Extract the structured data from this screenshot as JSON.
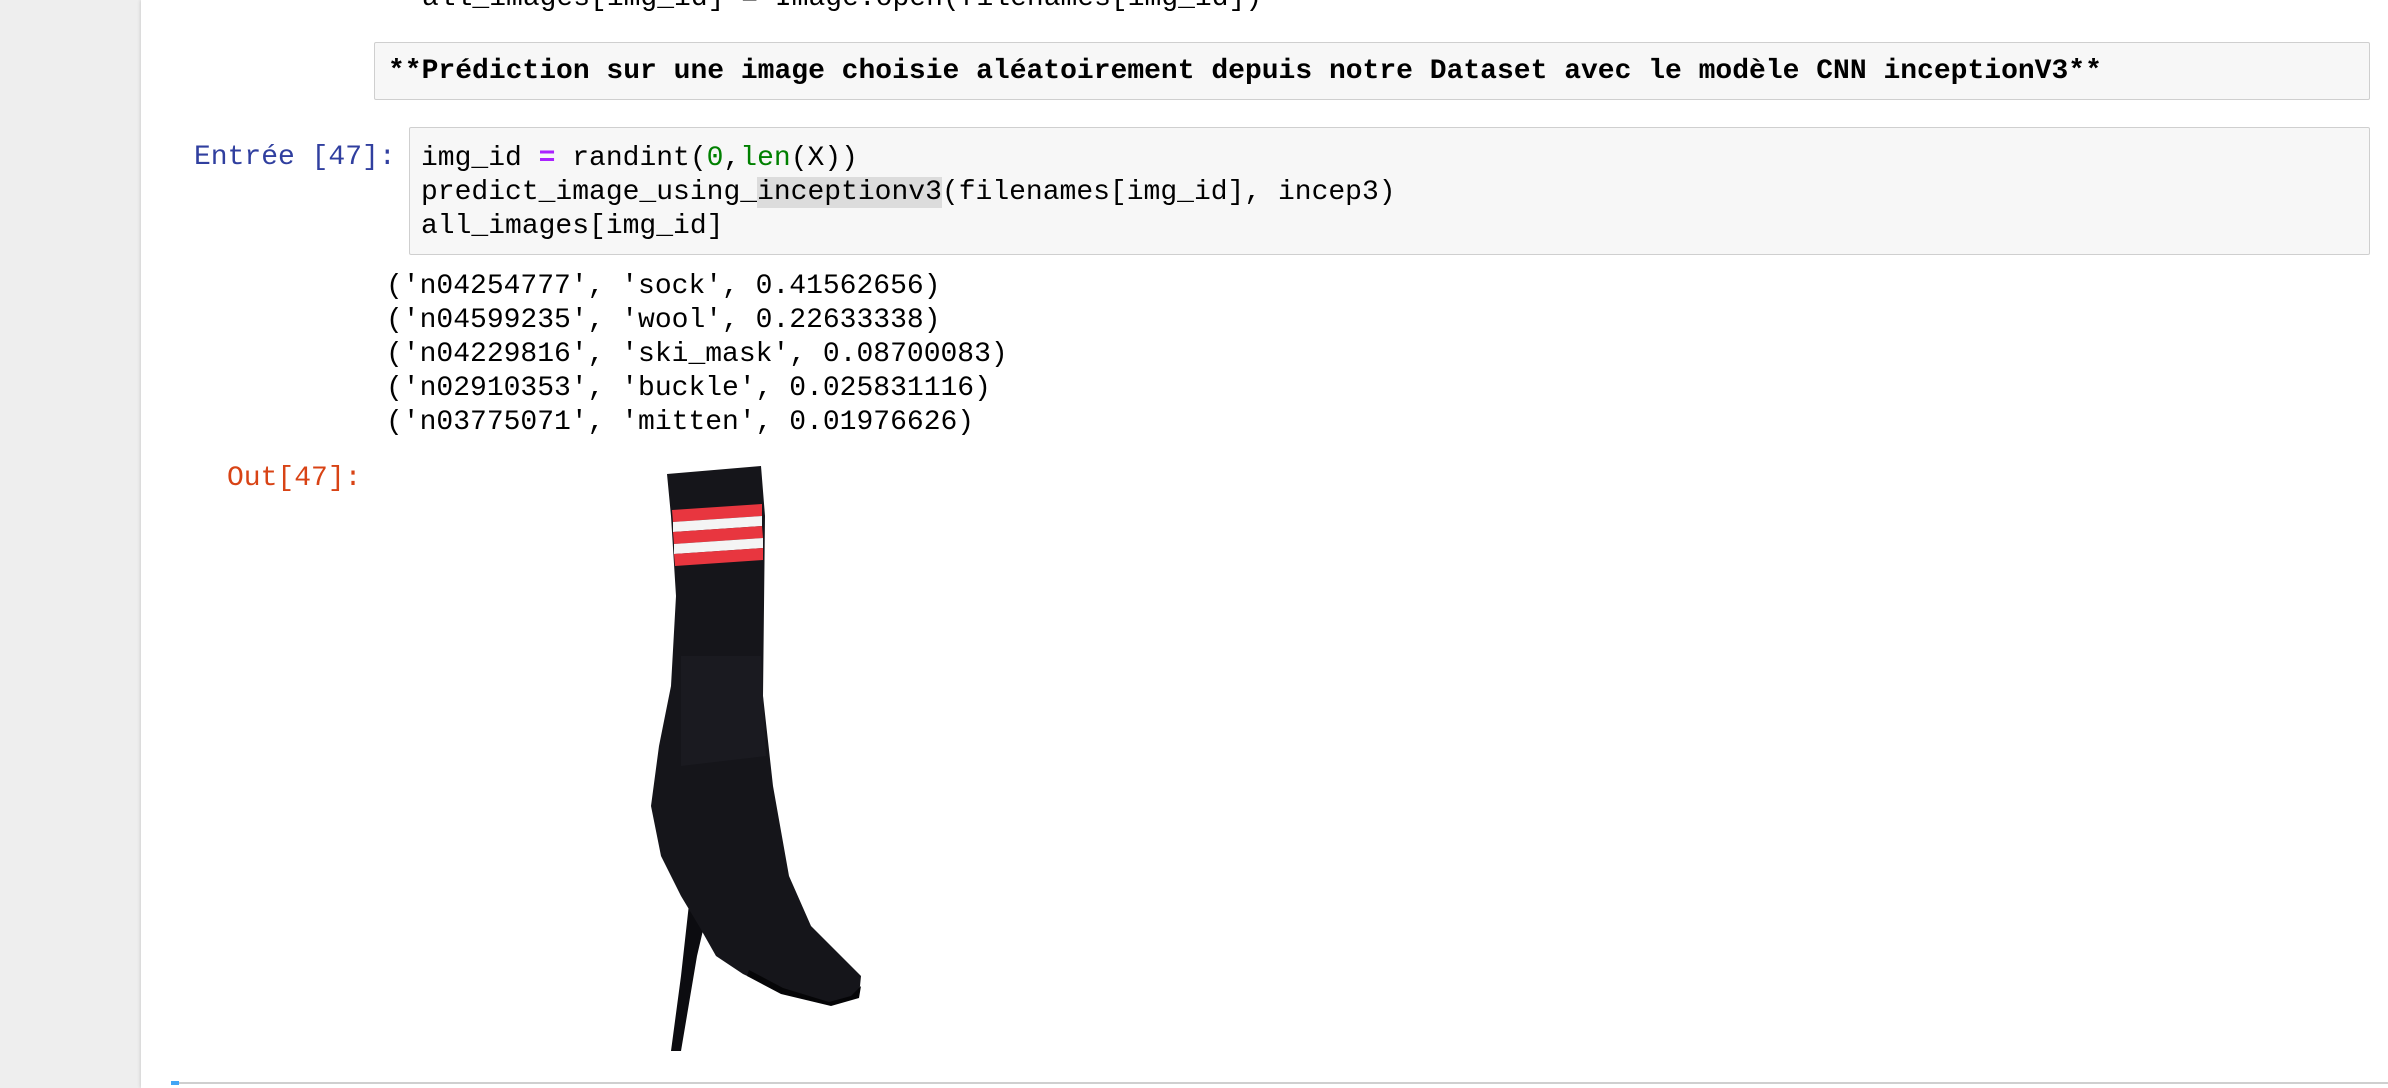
{
  "previous_cell": {
    "partial_line": "all_images[img_id] = Image.open(filenames[img_id])"
  },
  "markdown_cell": {
    "text": "**Prédiction sur une image choisie aléatoirement depuis notre Dataset avec le modèle CNN inceptionV3**"
  },
  "code_cell": {
    "prompt": "Entrée [47]:",
    "line1": {
      "a": "img_id ",
      "op": "=",
      "b": " randint(",
      "num": "0",
      "c": ",",
      "builtin": "len",
      "d": "(X))"
    },
    "line2": {
      "a": "predict_image_using_",
      "highlight": "inceptionv3",
      "b": "(filenames[img_id], incep3)"
    },
    "line3": "all_images[img_id]"
  },
  "stdout": [
    "('n04254777', 'sock', 0.41562656)",
    "('n04599235', 'wool', 0.22633338)",
    "('n04229816', 'ski_mask', 0.08700083)",
    "('n02910353', 'buckle', 0.025831116)",
    "('n03775071', 'mitten', 0.01976626)"
  ],
  "output": {
    "prompt": "Out[47]:"
  },
  "colors": {
    "prompt_in": "#303f9f",
    "prompt_out": "#d84315",
    "operator": "#aa22ff",
    "number": "#008000",
    "builtin": "#008000",
    "boot_black": "#15151a",
    "stripe_red": "#e8363f"
  }
}
